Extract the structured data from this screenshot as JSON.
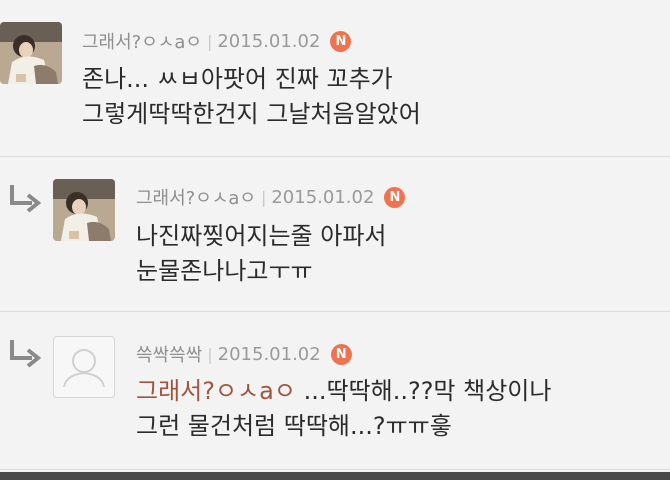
{
  "comments": [
    {
      "author": "그래서?ㅇㅅaㅇ",
      "date": "2015.01.02",
      "badge": "N",
      "lines": [
        "존나... ㅆㅂ아팟어 진짜 꼬추가",
        "그렇게딱딱한건지 그날처음알았어"
      ]
    },
    {
      "author": "그래서?ㅇㅅaㅇ",
      "date": "2015.01.02",
      "badge": "N",
      "lines": [
        "나진짜찢어지는줄 아파서",
        "눈물존나나고ㅜㅠ"
      ]
    },
    {
      "author": "쓱싹쓱싹",
      "date": "2015.01.02",
      "badge": "N",
      "mention": "그래서?ㅇㅅaㅇ",
      "line1_rest": " ...딱딱해..??막 책상이나",
      "line2": "그런 물건처럼 딱딱해...?ㅠㅠ흫"
    }
  ],
  "colors": {
    "badge": "#f0734f",
    "mention": "#a0563e",
    "background": "#f3f3f3"
  },
  "icons": {
    "reply": "reply-arrow-icon",
    "default_avatar": "default-profile-icon"
  }
}
